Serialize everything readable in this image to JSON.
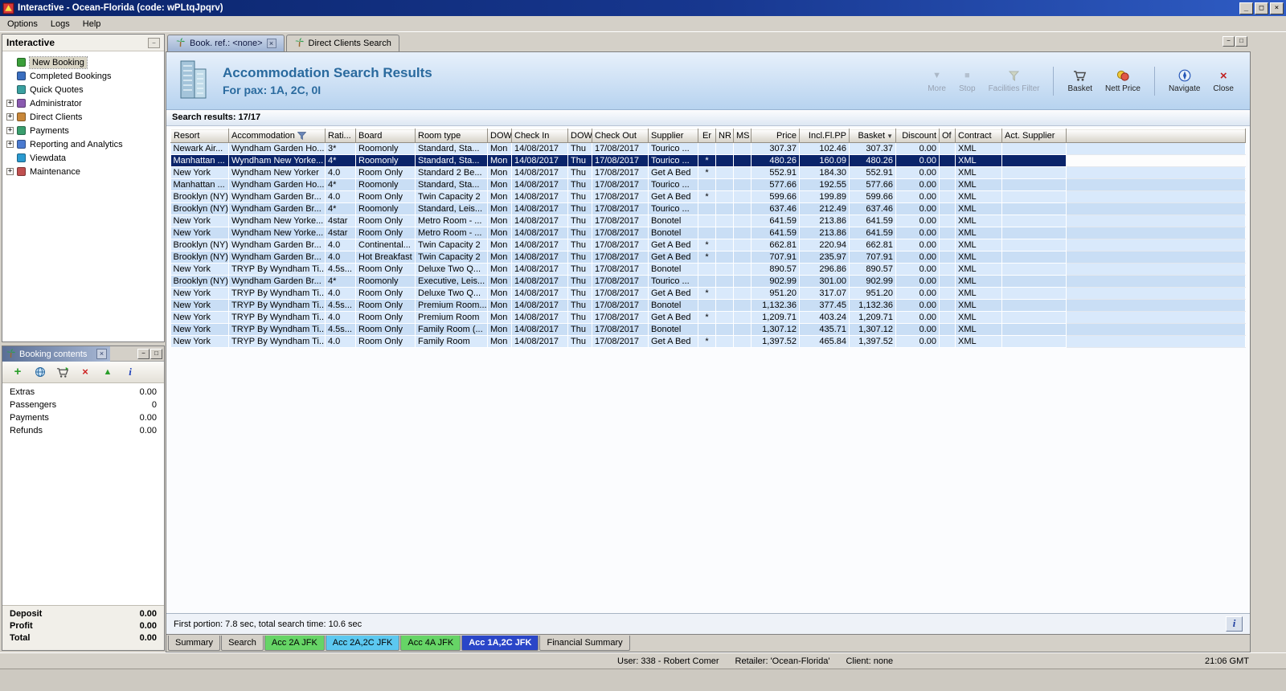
{
  "window": {
    "title": "Interactive - Ocean-Florida (code: wPLtqJpqrv)",
    "app_icon": "app-icon"
  },
  "menu": {
    "items": [
      "Options",
      "Logs",
      "Help"
    ]
  },
  "sidebar": {
    "title": "Interactive",
    "items": [
      {
        "label": "New Booking",
        "icon": "new-booking-icon",
        "icon_color": "#3a9e3a",
        "expandable": false,
        "selected": true
      },
      {
        "label": "Completed Bookings",
        "icon": "completed-bookings-icon",
        "icon_color": "#3a6ebf",
        "expandable": false,
        "selected": false
      },
      {
        "label": "Quick Quotes",
        "icon": "quick-quotes-icon",
        "icon_color": "#3aa0a0",
        "expandable": false,
        "selected": false
      },
      {
        "label": "Administrator",
        "icon": "administrator-icon",
        "icon_color": "#8a5ab0",
        "expandable": true,
        "selected": false
      },
      {
        "label": "Direct Clients",
        "icon": "direct-clients-icon",
        "icon_color": "#c8873a",
        "expandable": true,
        "selected": false
      },
      {
        "label": "Payments",
        "icon": "payments-icon",
        "icon_color": "#3a9e6e",
        "expandable": true,
        "selected": false
      },
      {
        "label": "Reporting and Analytics",
        "icon": "reporting-icon",
        "icon_color": "#4a7ad0",
        "expandable": true,
        "selected": false
      },
      {
        "label": "Viewdata",
        "icon": "viewdata-icon",
        "icon_color": "#2a9ad0",
        "expandable": false,
        "selected": false
      },
      {
        "label": "Maintenance",
        "icon": "maintenance-icon",
        "icon_color": "#c05050",
        "expandable": true,
        "selected": false
      }
    ]
  },
  "booking_contents": {
    "title": "Booking contents",
    "toolbar": [
      {
        "icon": "add-icon"
      },
      {
        "icon": "globe-icon"
      },
      {
        "icon": "basket-add-icon"
      },
      {
        "icon": "delete-icon"
      },
      {
        "icon": "upload-icon"
      },
      {
        "icon": "info-icon"
      }
    ],
    "rows": [
      {
        "label": "Extras",
        "value": "0.00"
      },
      {
        "label": "Passengers",
        "value": "0"
      },
      {
        "label": "Payments",
        "value": "0.00"
      },
      {
        "label": "Refunds",
        "value": "0.00"
      }
    ],
    "totals": [
      {
        "label": "Deposit",
        "value": "0.00"
      },
      {
        "label": "Profit",
        "value": "0.00"
      },
      {
        "label": "Total",
        "value": "0.00"
      }
    ]
  },
  "tabs": {
    "items": [
      {
        "label": "Book. ref.: <none>",
        "icon": "palm-icon",
        "active": true,
        "closable": true
      },
      {
        "label": "Direct Clients Search",
        "icon": "palm-icon",
        "active": false,
        "closable": false
      }
    ]
  },
  "header": {
    "title": "Accommodation Search Results",
    "subtitle": "For pax: 1A, 2C, 0I",
    "icon": "building-icon"
  },
  "toolbar": {
    "buttons": [
      {
        "label": "More",
        "icon": "more-icon",
        "enabled": false,
        "divider_after": false
      },
      {
        "label": "Stop",
        "icon": "stop-icon",
        "enabled": false,
        "divider_after": false
      },
      {
        "label": "Facilities Filter",
        "icon": "filter-icon",
        "enabled": false,
        "divider_after": true
      },
      {
        "label": "Basket",
        "icon": "basket-icon",
        "enabled": true,
        "divider_after": false
      },
      {
        "label": "Nett Price",
        "icon": "nett-price-icon",
        "enabled": true,
        "divider_after": true
      },
      {
        "label": "Navigate",
        "icon": "navigate-icon",
        "enabled": true,
        "divider_after": false
      },
      {
        "label": "Close",
        "icon": "close-icon",
        "enabled": true,
        "divider_after": false
      }
    ]
  },
  "results": {
    "summary": "Search results: 17/17",
    "selected_index": 1,
    "header_icons": {
      "1": "filter-small-icon",
      "15": "sort-desc-icon"
    },
    "columns": [
      "Resort",
      "Accommodation",
      "Rati...",
      "Board",
      "Room type",
      "DOW",
      "Check In",
      "DOW",
      "Check Out",
      "Supplier",
      "Er",
      "NR",
      "MS",
      "Price",
      "Incl.Fl.PP",
      "Basket",
      "Discount",
      "Of",
      "Contract",
      "Act. Supplier"
    ],
    "rows": [
      [
        "Newark Air...",
        "Wyndham Garden Ho...",
        "3*",
        "Roomonly",
        "Standard, Sta...",
        "Mon",
        "14/08/2017",
        "Thu",
        "17/08/2017",
        "Tourico ...",
        "",
        "",
        "",
        "307.37",
        "102.46",
        "307.37",
        "0.00",
        "",
        "XML",
        ""
      ],
      [
        "Manhattan ...",
        "Wyndham New Yorke...",
        "4*",
        "Roomonly",
        "Standard, Sta...",
        "Mon",
        "14/08/2017",
        "Thu",
        "17/08/2017",
        "Tourico ...",
        "*",
        "",
        "",
        "480.26",
        "160.09",
        "480.26",
        "0.00",
        "",
        "XML",
        ""
      ],
      [
        "New York",
        "Wyndham New Yorker",
        "4.0",
        "Room Only",
        "Standard 2 Be...",
        "Mon",
        "14/08/2017",
        "Thu",
        "17/08/2017",
        "Get A Bed",
        "*",
        "",
        "",
        "552.91",
        "184.30",
        "552.91",
        "0.00",
        "",
        "XML",
        ""
      ],
      [
        "Manhattan ...",
        "Wyndham Garden Ho...",
        "4*",
        "Roomonly",
        "Standard, Sta...",
        "Mon",
        "14/08/2017",
        "Thu",
        "17/08/2017",
        "Tourico ...",
        "",
        "",
        "",
        "577.66",
        "192.55",
        "577.66",
        "0.00",
        "",
        "XML",
        ""
      ],
      [
        "Brooklyn (NY)",
        "Wyndham Garden Br...",
        "4.0",
        "Room Only",
        "Twin Capacity 2",
        "Mon",
        "14/08/2017",
        "Thu",
        "17/08/2017",
        "Get A Bed",
        "*",
        "",
        "",
        "599.66",
        "199.89",
        "599.66",
        "0.00",
        "",
        "XML",
        ""
      ],
      [
        "Brooklyn (NY)",
        "Wyndham Garden Br...",
        "4*",
        "Roomonly",
        "Standard, Leis...",
        "Mon",
        "14/08/2017",
        "Thu",
        "17/08/2017",
        "Tourico ...",
        "",
        "",
        "",
        "637.46",
        "212.49",
        "637.46",
        "0.00",
        "",
        "XML",
        ""
      ],
      [
        "New York",
        "Wyndham New Yorke...",
        "4star",
        "Room Only",
        "Metro Room - ...",
        "Mon",
        "14/08/2017",
        "Thu",
        "17/08/2017",
        "Bonotel",
        "",
        "",
        "",
        "641.59",
        "213.86",
        "641.59",
        "0.00",
        "",
        "XML",
        ""
      ],
      [
        "New York",
        "Wyndham New Yorke...",
        "4star",
        "Room Only",
        "Metro Room - ...",
        "Mon",
        "14/08/2017",
        "Thu",
        "17/08/2017",
        "Bonotel",
        "",
        "",
        "",
        "641.59",
        "213.86",
        "641.59",
        "0.00",
        "",
        "XML",
        ""
      ],
      [
        "Brooklyn (NY)",
        "Wyndham Garden Br...",
        "4.0",
        "Continental...",
        "Twin Capacity 2",
        "Mon",
        "14/08/2017",
        "Thu",
        "17/08/2017",
        "Get A Bed",
        "*",
        "",
        "",
        "662.81",
        "220.94",
        "662.81",
        "0.00",
        "",
        "XML",
        ""
      ],
      [
        "Brooklyn (NY)",
        "Wyndham Garden Br...",
        "4.0",
        "Hot Breakfast",
        "Twin Capacity 2",
        "Mon",
        "14/08/2017",
        "Thu",
        "17/08/2017",
        "Get A Bed",
        "*",
        "",
        "",
        "707.91",
        "235.97",
        "707.91",
        "0.00",
        "",
        "XML",
        ""
      ],
      [
        "New York",
        "TRYP By Wyndham Ti...",
        "4.5s...",
        "Room Only",
        "Deluxe Two Q...",
        "Mon",
        "14/08/2017",
        "Thu",
        "17/08/2017",
        "Bonotel",
        "",
        "",
        "",
        "890.57",
        "296.86",
        "890.57",
        "0.00",
        "",
        "XML",
        ""
      ],
      [
        "Brooklyn (NY)",
        "Wyndham Garden Br...",
        "4*",
        "Roomonly",
        "Executive, Leis...",
        "Mon",
        "14/08/2017",
        "Thu",
        "17/08/2017",
        "Tourico ...",
        "",
        "",
        "",
        "902.99",
        "301.00",
        "902.99",
        "0.00",
        "",
        "XML",
        ""
      ],
      [
        "New York",
        "TRYP By Wyndham Ti...",
        "4.0",
        "Room Only",
        "Deluxe Two Q...",
        "Mon",
        "14/08/2017",
        "Thu",
        "17/08/2017",
        "Get A Bed",
        "*",
        "",
        "",
        "951.20",
        "317.07",
        "951.20",
        "0.00",
        "",
        "XML",
        ""
      ],
      [
        "New York",
        "TRYP By Wyndham Ti...",
        "4.5s...",
        "Room Only",
        "Premium Room...",
        "Mon",
        "14/08/2017",
        "Thu",
        "17/08/2017",
        "Bonotel",
        "",
        "",
        "",
        "1,132.36",
        "377.45",
        "1,132.36",
        "0.00",
        "",
        "XML",
        ""
      ],
      [
        "New York",
        "TRYP By Wyndham Ti...",
        "4.0",
        "Room Only",
        "Premium Room",
        "Mon",
        "14/08/2017",
        "Thu",
        "17/08/2017",
        "Get A Bed",
        "*",
        "",
        "",
        "1,209.71",
        "403.24",
        "1,209.71",
        "0.00",
        "",
        "XML",
        ""
      ],
      [
        "New York",
        "TRYP By Wyndham Ti...",
        "4.5s...",
        "Room Only",
        "Family Room (...",
        "Mon",
        "14/08/2017",
        "Thu",
        "17/08/2017",
        "Bonotel",
        "",
        "",
        "",
        "1,307.12",
        "435.71",
        "1,307.12",
        "0.00",
        "",
        "XML",
        ""
      ],
      [
        "New York",
        "TRYP By Wyndham Ti...",
        "4.0",
        "Room Only",
        "Family Room",
        "Mon",
        "14/08/2017",
        "Thu",
        "17/08/2017",
        "Get A Bed",
        "*",
        "",
        "",
        "1,397.52",
        "465.84",
        "1,397.52",
        "0.00",
        "",
        "XML",
        ""
      ]
    ]
  },
  "timing": {
    "text": "First portion: 7.8 sec, total search time: 10.6 sec"
  },
  "bottom_tabs": {
    "colors": {
      "green": "#66d466",
      "cyan": "#5cc8f0",
      "blue": "#2a46c8"
    },
    "items": [
      {
        "label": "Summary",
        "style": "plain",
        "active": false
      },
      {
        "label": "Search",
        "style": "plain",
        "active": false
      },
      {
        "label": "Acc 2A JFK",
        "style": "green",
        "active": false
      },
      {
        "label": "Acc 2A,2C JFK",
        "style": "cyan",
        "active": false
      },
      {
        "label": "Acc 4A JFK",
        "style": "green",
        "active": false
      },
      {
        "label": "Acc 1A,2C JFK",
        "style": "blue",
        "active": true
      },
      {
        "label": "Financial Summary",
        "style": "plain",
        "active": false
      }
    ]
  },
  "statusbar": {
    "user": "User: 338 - Robert Comer",
    "retailer": "Retailer: 'Ocean-Florida'",
    "client": "Client: none",
    "time": "21:06 GMT"
  }
}
